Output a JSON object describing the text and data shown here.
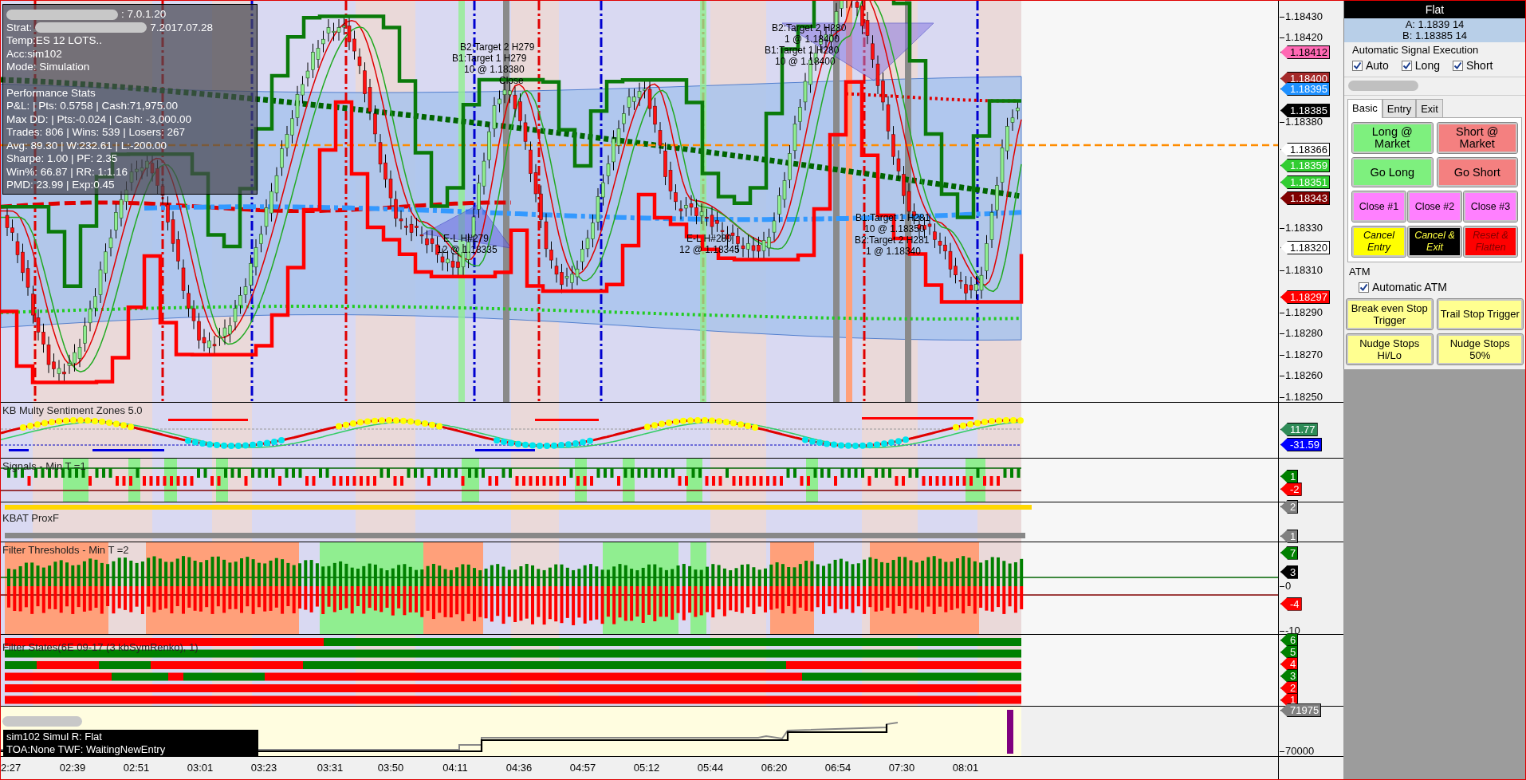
{
  "chart": {
    "header_lines": [
      {
        "value": ": 7.0.1.20",
        "redacted": true
      },
      {
        "label": "Strat:",
        "value": "7.2017.07.28",
        "redacted": true
      },
      {
        "value": "Temp:ES 12 LOTS..",
        "redacted": false
      },
      {
        "value": "Acc:sim102",
        "redacted": false
      },
      {
        "value": "Mode: Simulation",
        "redacted": false
      }
    ],
    "stats_title": "Performance Stats",
    "stats_lines": [
      "P&L: | Pts: 0.5758 | Cash:71,975.00",
      "Max DD: | Pts:-0.024 | Cash: -3,000.00",
      "Trades: 806 | Wins: 539 | Losers: 267",
      "Avg: 89.30 | W:232.61 | L:-200.00",
      "Sharpe: 1.00 | PF: 2.35",
      "Win%: 66.87 | RR: 1:1.16",
      "PMD: 23.99 | Exp:0.45"
    ],
    "annotations": [
      "B2:Target 2 H279",
      "B1:Target 1 H279",
      "10 @ 1.18380",
      "Close",
      "E-L H#279",
      "12 @ 1.18335",
      "E-L H#280",
      "12 @ 1.18345",
      "B2:Target 2 H280",
      "1 @ 1.18400",
      "B1:Target 1 H280",
      "10 @ 1.18400",
      "B1:Target 1 H281",
      "10 @ 1.18350",
      "B2:Target 2 H281",
      "1 @ 1.18340"
    ],
    "price_ticks": [
      "1.18430",
      "1.18420",
      "1.18380",
      "1.18330",
      "1.18310",
      "1.18290",
      "1.18280",
      "1.18270",
      "1.18260",
      "1.18250"
    ],
    "price_markers": [
      {
        "text": "1.18412",
        "color": "#ff69b4"
      },
      {
        "text": "1.18400",
        "color": "#a52a2a"
      },
      {
        "text": "1.18395",
        "color": "#1e90ff"
      },
      {
        "text": "1.18385",
        "color": "#000000"
      },
      {
        "text": "1.18366",
        "color": "#ffffff"
      },
      {
        "text": "1.18359",
        "color": "#32cd32"
      },
      {
        "text": "1.18351",
        "color": "#32cd32"
      },
      {
        "text": "1.18343",
        "color": "#800000"
      },
      {
        "text": "1.18320",
        "color": "#ffffff"
      },
      {
        "text": "1.18297",
        "color": "#ff0000"
      }
    ]
  },
  "panes": [
    {
      "kind": "sentiment",
      "title": "KB Multy Sentiment Zones 5.0",
      "markers": [
        {
          "text": "11.77",
          "color": "#2e8b57"
        },
        {
          "text": "-31.59",
          "color": "#0000ff"
        }
      ]
    },
    {
      "kind": "signals",
      "title": "Signals - Min T =1",
      "markers": [
        {
          "text": "1",
          "color": "#008000"
        },
        {
          "text": "-2",
          "color": "#ff0000"
        }
      ]
    },
    {
      "kind": "proxf",
      "title": "KBAT ProxF",
      "markers": [
        {
          "text": "2",
          "color": "#808080"
        },
        {
          "text": "1",
          "color": "#808080"
        }
      ]
    },
    {
      "kind": "thresholds",
      "title": "Filter Thresholds - Min T =2",
      "ticks": [
        "0",
        "-10"
      ],
      "markers": [
        {
          "text": "7",
          "color": "#008000"
        },
        {
          "text": "3",
          "color": "#000000"
        },
        {
          "text": "-4",
          "color": "#ff0000"
        }
      ]
    },
    {
      "kind": "states",
      "title": "Filter States(6E 09-17 (3 kbSymRenko), 1)",
      "markers": [
        {
          "text": "6",
          "color": "#008000"
        },
        {
          "text": "5",
          "color": "#008000"
        },
        {
          "text": "4",
          "color": "#ff0000"
        },
        {
          "text": "3",
          "color": "#008000"
        },
        {
          "text": "2",
          "color": "#ff0000"
        },
        {
          "text": "1",
          "color": "#ff0000"
        }
      ]
    },
    {
      "kind": "equity",
      "status_lines": [
        "sim102 Simul  R: Flat",
        "TOA:None TWF: WaitingNewEntry"
      ],
      "ticks": [
        "70000"
      ],
      "markers": [
        {
          "text": "71975",
          "color": "#808080"
        }
      ]
    }
  ],
  "time_labels": [
    "2:27",
    "02:39",
    "02:51",
    "03:01",
    "03:23",
    "03:31",
    "03:50",
    "04:11",
    "04:36",
    "04:57",
    "05:12",
    "05:44",
    "06:20",
    "06:54",
    "07:30",
    "08:01"
  ],
  "panel": {
    "position": "Flat",
    "ask": "A: 1.1839 14",
    "bid": "B: 1.18385 14",
    "auto_title": "Automatic Signal Execution",
    "auto_options": [
      {
        "label": "Auto",
        "checked": true
      },
      {
        "label": "Long",
        "checked": true
      },
      {
        "label": "Short",
        "checked": true
      }
    ],
    "account_redacted": true,
    "tabs": [
      {
        "label": "Basic",
        "selected": true
      },
      {
        "label": "Entry",
        "selected": false
      },
      {
        "label": "Exit",
        "selected": false
      }
    ],
    "buttons": [
      {
        "label": "Long @ Market",
        "kind": "long"
      },
      {
        "label": "Short @ Market",
        "kind": "short"
      },
      {
        "label": "Go Long",
        "kind": "long"
      },
      {
        "label": "Go Short",
        "kind": "short"
      },
      {
        "label": "Close #1",
        "kind": "close"
      },
      {
        "label": "Close #2",
        "kind": "close"
      },
      {
        "label": "Close #3",
        "kind": "close"
      },
      {
        "label": "Cancel Entry",
        "kind": "cancel"
      },
      {
        "label": "Cancel & Exit",
        "kind": "cancel-exit"
      },
      {
        "label": "Reset & Flatten",
        "kind": "reset"
      }
    ],
    "atm_title": "ATM",
    "atm_auto": {
      "label": "Automatic ATM",
      "checked": true
    },
    "atm_buttons": [
      "Break even Stop Trigger",
      "Trail Stop Trigger",
      "Nudge Stops Hi/Lo",
      "Nudge Stops 50%"
    ]
  }
}
